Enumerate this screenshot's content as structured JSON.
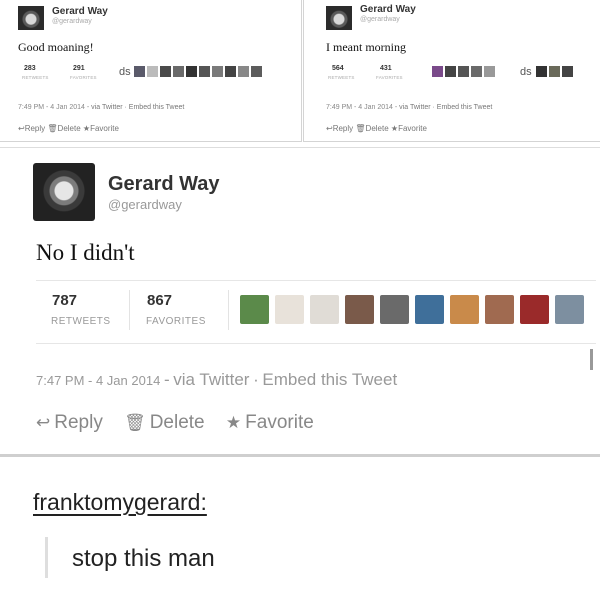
{
  "tweet_small_1": {
    "name": "Gerard Way",
    "handle": "@gerardway",
    "text": "Good moaning!",
    "retweets": "283",
    "retweets_label": "RETWEETS",
    "favorites": "291",
    "favorites_label": "FAVORITES",
    "avatar_badge": "ds",
    "date": "7:49 PM - 4 Jan 2014",
    "via": "via Twitter",
    "embed": "Embed this Tweet",
    "actions": {
      "reply": "Reply",
      "delete": "Delete",
      "favorite": "Favorite"
    }
  },
  "tweet_small_2": {
    "name": "Gerard Way",
    "handle": "@gerardway",
    "text": "I meant morning",
    "retweets": "564",
    "retweets_label": "RETWEETS",
    "favorites": "431",
    "favorites_label": "FAVORITES",
    "avatar_badge": "ds",
    "date": "7:49 PM - 4 Jan 2014",
    "via": "via Twitter",
    "embed": "Embed this Tweet",
    "actions": {
      "reply": "Reply",
      "delete": "Delete",
      "favorite": "Favorite"
    }
  },
  "tweet_main": {
    "name": "Gerard Way",
    "handle": "@gerardway",
    "text": "No I didn't",
    "retweets": "787",
    "retweets_label": "RETWEETS",
    "favorites": "867",
    "favorites_label": "FAVORITES",
    "date": "7:47 PM - 4 Jan 2014",
    "via": "via Twitter",
    "embed": "Embed this Tweet",
    "actions": {
      "reply": "Reply",
      "delete": "Delete",
      "favorite": "Favorite"
    },
    "favoriter_avatar_colors": [
      "#5b8a4a",
      "#e8e2da",
      "#e0dcd6",
      "#7a5a4a",
      "#6a6a6a",
      "#3f6f9a",
      "#c98a4a",
      "#a06a50",
      "#9a2a2a",
      "#7d8fa0"
    ]
  },
  "post": {
    "username": "franktomygerard:",
    "comment": "stop this man"
  },
  "icons": {
    "reply": "↩",
    "delete": "🗑",
    "favorite": "★"
  },
  "colors": {
    "muted": "#999999",
    "text": "#222222"
  }
}
